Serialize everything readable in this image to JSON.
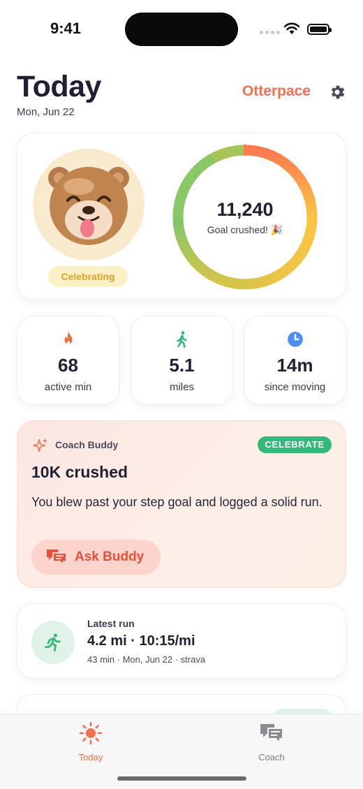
{
  "status_bar": {
    "time": "9:41"
  },
  "header": {
    "title": "Today",
    "date": "Mon, Jun 22",
    "brand": "Otterpace",
    "settings_icon": "gear-icon"
  },
  "hero": {
    "mood_label": "Celebrating",
    "steps": "11,240",
    "steps_caption": "Goal crushed! 🎉",
    "progress_fraction": 1.0,
    "ring_colors": [
      "#ff7a4f",
      "#fbc442",
      "#8fcf5c",
      "#e9c544"
    ]
  },
  "stats": [
    {
      "icon": "flame-icon",
      "value": "68",
      "label": "active min",
      "color": "#f26a3d"
    },
    {
      "icon": "walking-icon",
      "value": "5.1",
      "label": "miles",
      "color": "#33b97a"
    },
    {
      "icon": "clock-icon",
      "value": "14m",
      "label": "since moving",
      "color": "#4c8df6"
    }
  ],
  "coach": {
    "name": "Coach Buddy",
    "badge": "CELEBRATE",
    "title": "10K crushed",
    "body": "You blew past your step goal and logged a solid run.",
    "button_label": "Ask Buddy"
  },
  "latest_run": {
    "label": "Latest run",
    "summary": "4.2 mi · 10:15/mi",
    "meta": "43 min · Mon, Jun 22 · strava"
  },
  "tabbar": {
    "items": [
      {
        "label": "Today",
        "icon": "sun-icon",
        "active": true
      },
      {
        "label": "Coach",
        "icon": "chat-bubbles-icon",
        "active": false
      }
    ]
  },
  "colors": {
    "accent": "#f3704f",
    "success": "#33b97a"
  }
}
